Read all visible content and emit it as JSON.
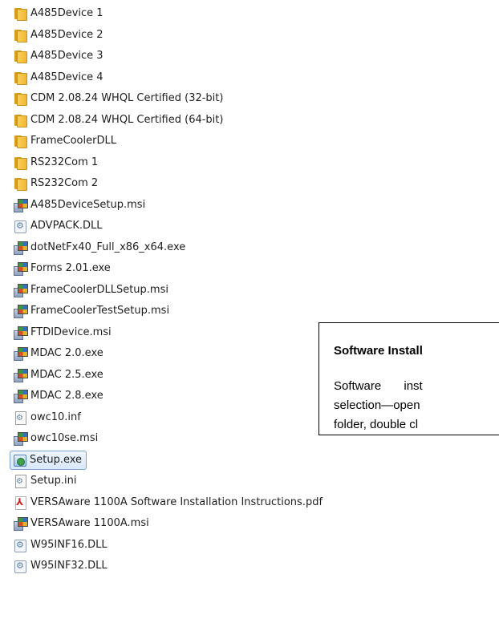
{
  "files": [
    {
      "name": "A485Device 1",
      "icon": "folder-icon",
      "type": "folder"
    },
    {
      "name": "A485Device 2",
      "icon": "folder-icon",
      "type": "folder"
    },
    {
      "name": "A485Device 3",
      "icon": "folder-icon",
      "type": "folder"
    },
    {
      "name": "A485Device 4",
      "icon": "folder-icon",
      "type": "folder"
    },
    {
      "name": "CDM 2.08.24 WHQL Certified (32-bit)",
      "icon": "folder-icon",
      "type": "folder"
    },
    {
      "name": "CDM 2.08.24 WHQL Certified (64-bit)",
      "icon": "folder-icon",
      "type": "folder"
    },
    {
      "name": "FrameCoolerDLL",
      "icon": "folder-icon",
      "type": "folder"
    },
    {
      "name": "RS232Com 1",
      "icon": "folder-icon",
      "type": "folder"
    },
    {
      "name": "RS232Com 2",
      "icon": "folder-icon",
      "type": "folder"
    },
    {
      "name": "A485DeviceSetup.msi",
      "icon": "installer-icon",
      "type": "installer"
    },
    {
      "name": "ADVPACK.DLL",
      "icon": "dll-icon",
      "type": "dll"
    },
    {
      "name": "dotNetFx40_Full_x86_x64.exe",
      "icon": "installer-icon",
      "type": "installer"
    },
    {
      "name": "Forms 2.01.exe",
      "icon": "installer-icon",
      "type": "installer"
    },
    {
      "name": "FrameCoolerDLLSetup.msi",
      "icon": "installer-icon",
      "type": "installer"
    },
    {
      "name": "FrameCoolerTestSetup.msi",
      "icon": "installer-icon",
      "type": "installer"
    },
    {
      "name": "FTDIDevice.msi",
      "icon": "installer-icon",
      "type": "installer"
    },
    {
      "name": "MDAC 2.0.exe",
      "icon": "installer-icon",
      "type": "installer"
    },
    {
      "name": "MDAC 2.5.exe",
      "icon": "installer-icon",
      "type": "installer"
    },
    {
      "name": "MDAC 2.8.exe",
      "icon": "installer-icon",
      "type": "installer"
    },
    {
      "name": "owc10.inf",
      "icon": "config-icon",
      "type": "config"
    },
    {
      "name": "owc10se.msi",
      "icon": "installer-icon",
      "type": "installer"
    },
    {
      "name": "Setup.exe",
      "icon": "setup-icon",
      "type": "setup",
      "selected": true
    },
    {
      "name": "Setup.ini",
      "icon": "config-icon",
      "type": "config"
    },
    {
      "name": "VERSAware 1100A Software Installation Instructions.pdf",
      "icon": "pdf-icon",
      "type": "pdf"
    },
    {
      "name": "VERSAware 1100A.msi",
      "icon": "installer-icon",
      "type": "installer"
    },
    {
      "name": "W95INF16.DLL",
      "icon": "dll-icon",
      "type": "dll"
    },
    {
      "name": "W95INF32.DLL",
      "icon": "dll-icon",
      "type": "dll"
    }
  ],
  "callout": {
    "title": "Software Install",
    "line1": "Software inst",
    "line2": "selection—open",
    "line3": "folder, double cl"
  },
  "colors": {
    "selection_border": "#7da2ce",
    "selection_fill": "#d9e8fb",
    "folder": "#f2b735"
  }
}
